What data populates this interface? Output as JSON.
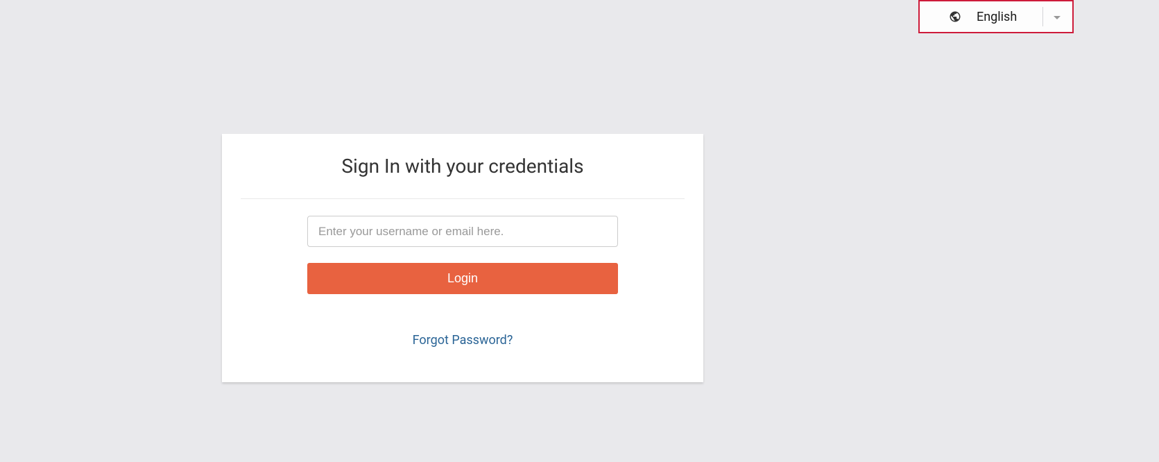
{
  "language_selector": {
    "current_language": "English"
  },
  "login": {
    "heading": "Sign In with your credentials",
    "username_placeholder": "Enter your username or email here.",
    "login_button_label": "Login",
    "forgot_password_label": "Forgot Password?"
  },
  "colors": {
    "background": "#e9e9ec",
    "card_bg": "#ffffff",
    "accent": "#e86240",
    "highlight_border": "#cd1b3a",
    "link": "#2a6496"
  }
}
